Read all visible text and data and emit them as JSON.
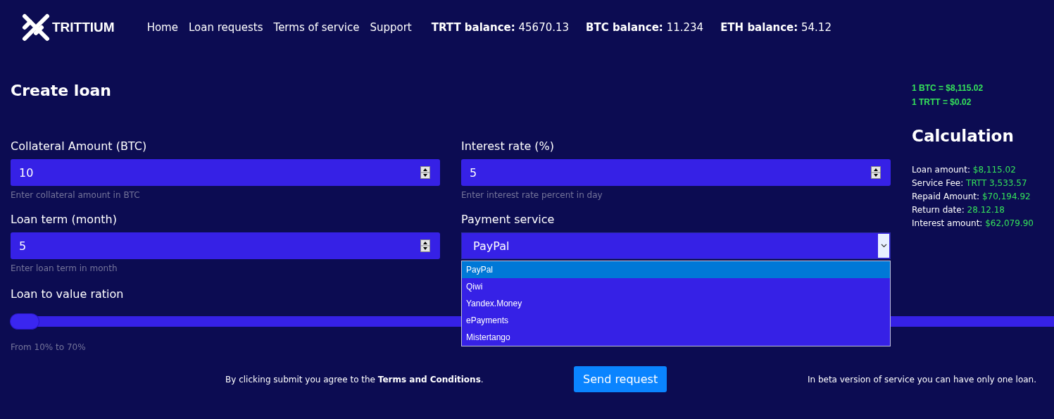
{
  "header": {
    "logo": "TRITTIUM",
    "nav": [
      "Home",
      "Loan requests",
      "Terms of service",
      "Support"
    ],
    "balances": [
      {
        "label": "TRTT balance:",
        "value": "45670.13"
      },
      {
        "label": "BTC balance:",
        "value": "11.234"
      },
      {
        "label": "ETH balance:",
        "value": "54.12"
      }
    ]
  },
  "page_title": "Create loan",
  "rates": [
    "1 BTC = $8,115.02",
    "1 TRTT = $0.02"
  ],
  "fields": [
    {
      "label": "Collateral Amount (BTC)",
      "value": "10",
      "hint": "Enter collateral amount in BTC"
    },
    {
      "label": "Interest rate (%)",
      "value": "5",
      "hint": "Enter interest rate percent in day"
    },
    {
      "label": "Loan term (month)",
      "value": "5",
      "hint": "Enter loan term in month"
    }
  ],
  "payment_service": {
    "label": "Payment service",
    "value": "PayPal",
    "expanded": true,
    "options": [
      {
        "label": "PayPal",
        "selected": true
      },
      {
        "label": "Qiwi",
        "selected": false
      },
      {
        "label": "Yandex.Money",
        "selected": false
      },
      {
        "label": "ePayments",
        "selected": false
      },
      {
        "label": "Mistertango",
        "selected": false
      }
    ]
  },
  "ltv": {
    "label": "Loan to value ration",
    "level": 0,
    "hint": "From 10% to 70%"
  },
  "calculation": {
    "title": "Calculation",
    "rows": [
      {
        "label": "Loan amount:",
        "value": "$8,115.02"
      },
      {
        "label": "Service Fee:",
        "value": "TRTT 3,533.57"
      },
      {
        "label": "Repaid Amount:",
        "value": "$70,194.92"
      },
      {
        "label": "Return date:",
        "value": "28.12.18"
      },
      {
        "label": "Interest amount:",
        "value": "$62,079.90"
      }
    ]
  },
  "footer": {
    "agreement": "By clicking submit you agree to the **Terms and Conditions**.",
    "button": "Send request",
    "note": "In beta version of service you can have only one loan."
  }
}
